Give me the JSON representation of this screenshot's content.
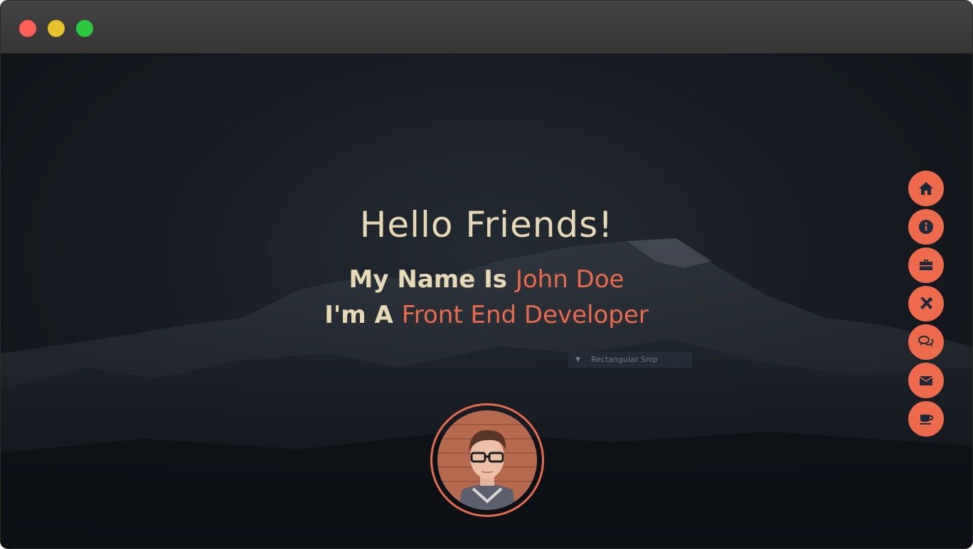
{
  "window": {
    "controls": [
      "close",
      "minimize",
      "maximize"
    ]
  },
  "hero": {
    "greeting": "Hello Friends!",
    "name_prefix": "My Name Is ",
    "name": "John Doe",
    "role_prefix": "I'm A ",
    "role": "Front End Developer"
  },
  "overlay": {
    "snip_label": "Rectangular Snip"
  },
  "side_nav": {
    "items": [
      {
        "icon": "home-icon"
      },
      {
        "icon": "info-icon"
      },
      {
        "icon": "briefcase-icon"
      },
      {
        "icon": "tools-icon"
      },
      {
        "icon": "comments-icon"
      },
      {
        "icon": "envelope-icon"
      },
      {
        "icon": "coffee-icon"
      }
    ]
  },
  "colors": {
    "accent": "#ec6a4c",
    "text": "#e6d9b6",
    "background": "#10151b",
    "icon": "#1e2a3a"
  }
}
